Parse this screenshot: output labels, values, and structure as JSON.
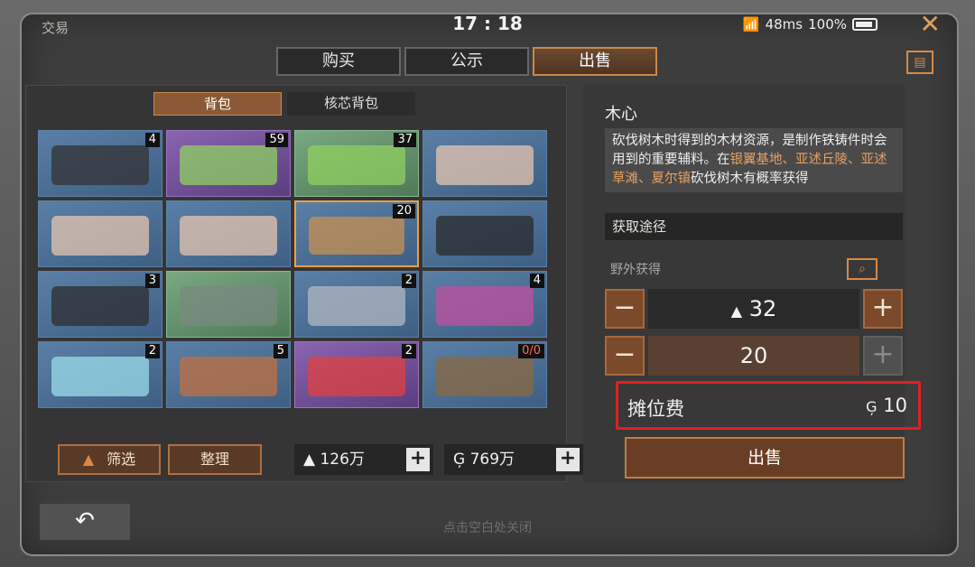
{
  "window": {
    "title": "交易",
    "time": "17 : 18",
    "network": "48ms",
    "battery": "100%"
  },
  "tabs": [
    {
      "label": "购买"
    },
    {
      "label": "公示"
    },
    {
      "label": "出售"
    }
  ],
  "bag_tabs": [
    {
      "label": "背包"
    },
    {
      "label": "核芯背包"
    }
  ],
  "grid": [
    {
      "rarity": "blue",
      "count": "4",
      "icon": "rifle-icon"
    },
    {
      "rarity": "purple",
      "count": "59",
      "icon": "syringe-icon"
    },
    {
      "rarity": "green",
      "count": "37",
      "icon": "syringe-icon"
    },
    {
      "rarity": "blue",
      "count": "",
      "icon": "meat-dish-icon"
    },
    {
      "rarity": "blue",
      "count": "",
      "icon": "meat-dish-icon"
    },
    {
      "rarity": "blue",
      "count": "",
      "icon": "meat-dish-icon"
    },
    {
      "rarity": "blue",
      "count": "20",
      "icon": "wood-planks-icon"
    },
    {
      "rarity": "blue",
      "count": "",
      "icon": "armor-plate-icon"
    },
    {
      "rarity": "blue",
      "count": "3",
      "icon": "handguard-icon"
    },
    {
      "rarity": "green",
      "count": "",
      "icon": "ore-icon"
    },
    {
      "rarity": "blue",
      "count": "2",
      "icon": "steel-bars-icon"
    },
    {
      "rarity": "blue",
      "count": "4",
      "icon": "cloth-icon"
    },
    {
      "rarity": "blue",
      "count": "2",
      "icon": "fabric-icon"
    },
    {
      "rarity": "blue",
      "count": "5",
      "icon": "potion-icon"
    },
    {
      "rarity": "purple",
      "count": "2",
      "icon": "capsule-icon"
    },
    {
      "rarity": "blue",
      "count": "0/0",
      "icon": "fishing-rod-icon"
    }
  ],
  "controls": {
    "filter_label": "筛选",
    "sort_label": "整理",
    "currency_a": "126万",
    "currency_b": "769万"
  },
  "detail": {
    "name": "木心",
    "desc_prefix": "砍伐树木时得到的木材资源，是制作铁铸件时会用到的重要辅料。在",
    "desc_highlight": "银翼基地、亚述丘陵、亚述草滩、夏尔镇",
    "desc_suffix": "砍伐树木有概率获得",
    "source_header": "获取途径",
    "source_value": "野外获得",
    "price": "32",
    "quantity": "20",
    "fee_label": "摊位费",
    "fee_value": "10",
    "sell_label": "出售"
  },
  "hint": "点击空白处关闭",
  "colors": {
    "accent": "#c88a4a",
    "highlight": "#e8a060",
    "fee_box": "#e02020"
  }
}
